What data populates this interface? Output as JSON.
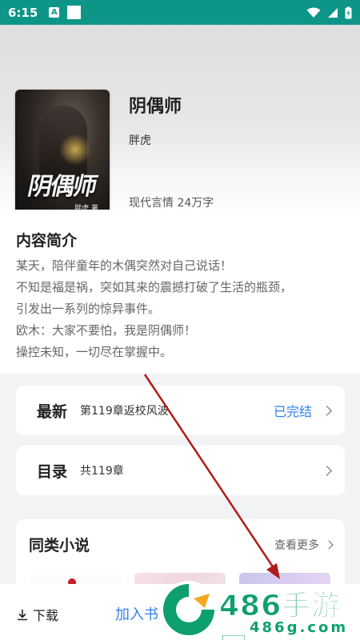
{
  "status_bar": {
    "time": "6:15",
    "a_badge": "A"
  },
  "book": {
    "cover_title": "阴偶师",
    "cover_author": "胖虎 著",
    "title": "阴偶师",
    "author": "胖虎",
    "meta": "现代言情 24万字"
  },
  "intro": {
    "title": "内容简介",
    "lines": [
      "某天，陪伴童年的木偶突然对自己说话！",
      "不知是福是祸，突如其来的震撼打破了生活的瓶颈，",
      "引发出一系列的惊异事件。",
      "欧木：大家不要怕，我是阴偶师！",
      "操控未知，一切尽在掌握中。"
    ]
  },
  "latest": {
    "label": "最新",
    "value": "第119章返校风波",
    "status": "已完结"
  },
  "toc": {
    "label": "目录",
    "value": "共119章"
  },
  "similar": {
    "title": "同类小说",
    "see_more": "查看更多"
  },
  "bottom_bar": {
    "download": "下载",
    "add_shelf": "加入书"
  },
  "watermark": {
    "text": "486手游网",
    "domain": "486g.com"
  },
  "colors": {
    "accent": "#2f80ed",
    "status_bar": "#0d9688",
    "arrow": "#b01c1c",
    "watermark": "#0e9f6e"
  }
}
